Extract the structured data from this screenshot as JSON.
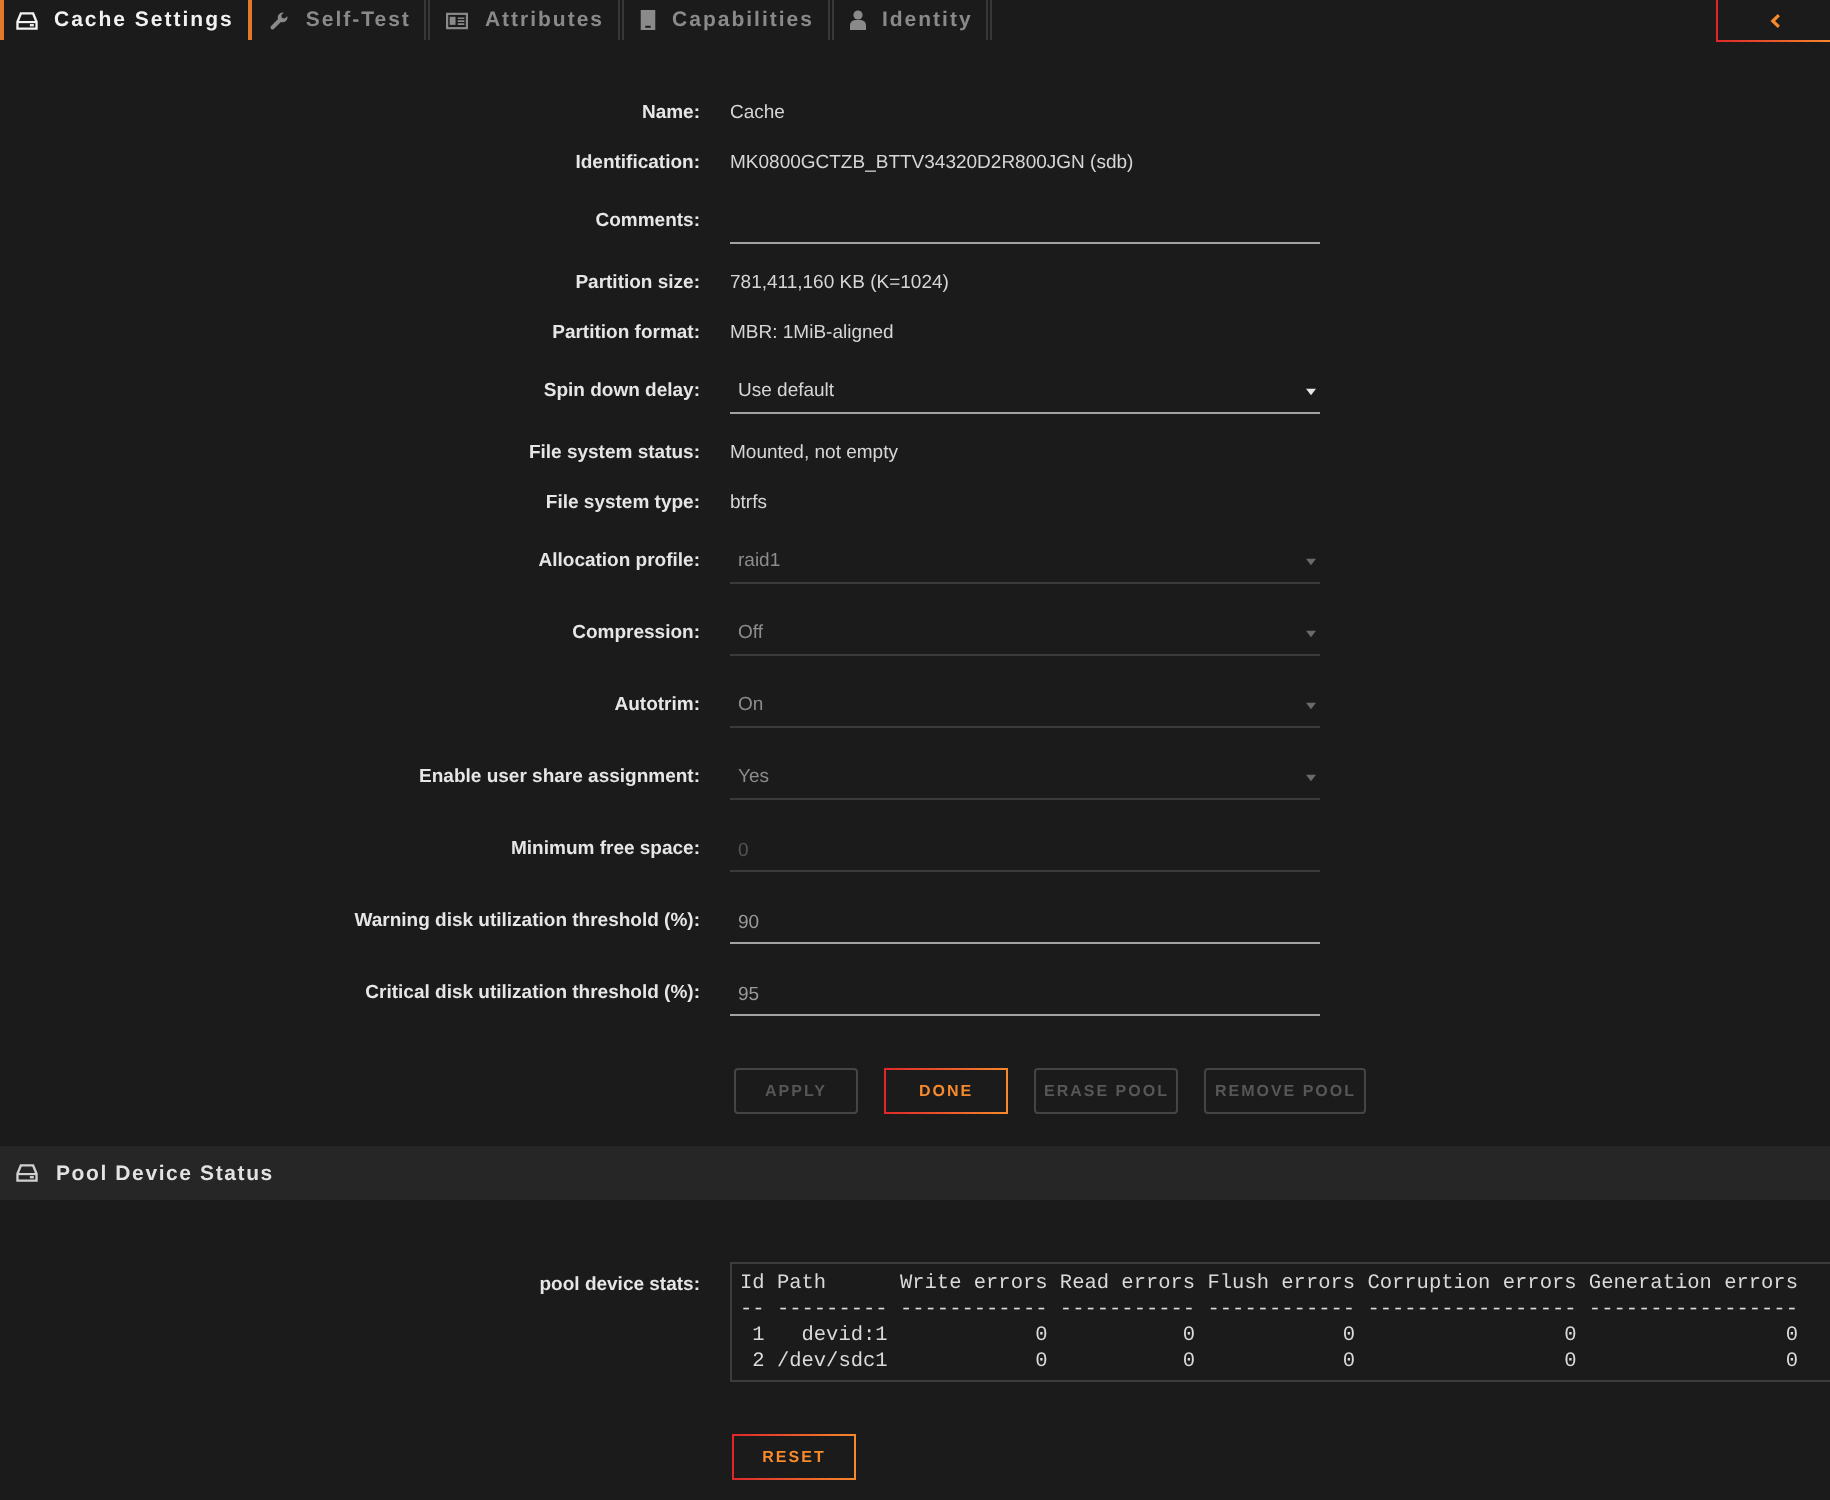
{
  "tabs": [
    {
      "label": "Cache Settings",
      "selected": true
    },
    {
      "label": "Self-Test",
      "selected": false
    },
    {
      "label": "Attributes",
      "selected": false
    },
    {
      "label": "Capabilities",
      "selected": false
    },
    {
      "label": "Identity",
      "selected": false
    }
  ],
  "settings": [
    {
      "label": "Name:",
      "kind": "text",
      "value": "Cache"
    },
    {
      "label": "Identification:",
      "kind": "text",
      "value": "MK0800GCTZB_BTTV34320D2R800JGN (sdb)"
    },
    {
      "label": "Comments:",
      "kind": "input",
      "disabled": false
    },
    {
      "label": "Partition size:",
      "kind": "text",
      "value": "781,411,160 KB (K=1024)"
    },
    {
      "label": "Partition format:",
      "kind": "text",
      "value": "MBR: 1MiB-aligned"
    },
    {
      "label": "Spin down delay:",
      "kind": "select",
      "value": "Use default",
      "disabled": false
    },
    {
      "label": "File system status:",
      "kind": "text",
      "value": "Mounted, not empty"
    },
    {
      "label": "File system type:",
      "kind": "text",
      "value": "btrfs"
    },
    {
      "label": "Allocation profile:",
      "kind": "select",
      "value": "raid1",
      "disabled": true
    },
    {
      "label": "Compression:",
      "kind": "select",
      "value": "Off",
      "disabled": true
    },
    {
      "label": "Autotrim:",
      "kind": "select",
      "value": "On",
      "disabled": true
    },
    {
      "label": "Enable user share assignment:",
      "kind": "select",
      "value": "Yes",
      "disabled": true
    },
    {
      "label": "Minimum free space:",
      "kind": "input",
      "placeholder": "0",
      "disabled": true
    },
    {
      "label": "Warning disk utilization threshold (%):",
      "kind": "input",
      "placeholder": "90",
      "disabled": false
    },
    {
      "label": "Critical disk utilization threshold (%):",
      "kind": "input",
      "placeholder": "95",
      "disabled": false
    }
  ],
  "buttons": [
    {
      "label": "APPLY",
      "disabled": true
    },
    {
      "label": "DONE",
      "disabled": false
    },
    {
      "label": "ERASE POOL",
      "disabled": true
    },
    {
      "label": "REMOVE POOL",
      "disabled": true
    }
  ],
  "pool_status": {
    "title": "Pool Device Status",
    "label": "pool device stats:",
    "lines": [
      "Id Path      Write errors Read errors Flush errors Corruption errors Generation errors",
      "-- --------- ------------ ----------- ------------ ----------------- -----------------",
      " 1   devid:1            0           0            0                 0                 0",
      " 2 /dev/sdc1            0           0            0                 0                 0"
    ],
    "reset_button": "RESET"
  }
}
